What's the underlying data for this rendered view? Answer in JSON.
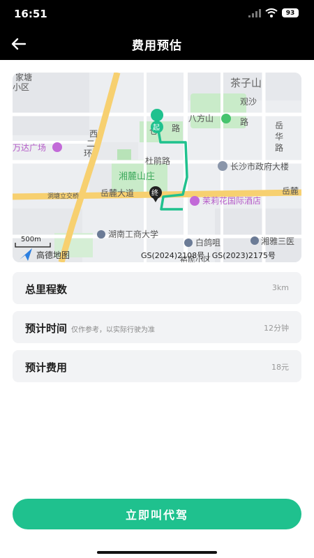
{
  "status_bar": {
    "time": "16:51",
    "battery": "93"
  },
  "header": {
    "title": "费用预估"
  },
  "map": {
    "labels": {
      "jiatang": "家塘",
      "xiaoqu": "小区",
      "chaziShan": "茶子山",
      "guansha": "观沙",
      "lu1": "路",
      "xierhuan1": "西",
      "xierhuan2": "二",
      "xierhuan3": "环",
      "xiang": "仓",
      "lu2": "路",
      "bafangshan": "八方山",
      "yuehua1": "岳",
      "yuehua2": "华",
      "yuehua3": "路",
      "wandaguangchang": "万达广场",
      "dujuanlu": "杜鹃路",
      "xianglushanzhuang": "湘麓山庄",
      "changshagov": "长沙市政府大楼",
      "dongtangbridge": "洞塘立交桥",
      "yueludadao": "岳麓大道",
      "yuelu_right": "岳麓",
      "molihua": "茉莉花国际酒店",
      "hunangongshang": "湖南工商大学",
      "baigezui": "白鸽咀",
      "xiangya": "湘雅三医",
      "guicuixiaoqu": "裕民小区",
      "start_marker": "起",
      "end_marker": "终",
      "scale": "500m",
      "logo_text": "高德地图",
      "copyright": "GS(2024)2108号 | GS(2023)2175号"
    }
  },
  "rows": [
    {
      "label": "总里程数",
      "note": "",
      "value": "3km"
    },
    {
      "label": "预计时间",
      "note": "仅作参考，以实际行驶为准",
      "value": "12分钟"
    },
    {
      "label": "预计费用",
      "note": "",
      "value": "18元"
    }
  ],
  "action": {
    "label": "立即叫代驾"
  },
  "colors": {
    "accent": "#1fc18e",
    "route": "#1fc18e",
    "header_bg": "#000000"
  },
  "icons": [
    "back-arrow-icon",
    "wifi-icon",
    "signal-icon",
    "battery-icon",
    "amap-logo-icon"
  ]
}
